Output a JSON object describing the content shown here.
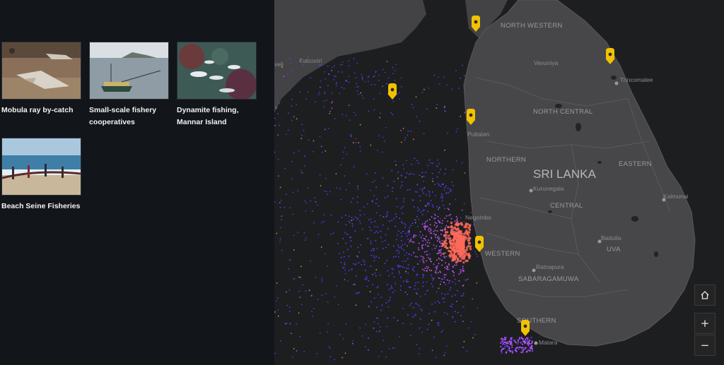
{
  "gallery": [
    {
      "caption": "Mobula ray by-catch"
    },
    {
      "caption": "Small-scale fishery cooperatives"
    },
    {
      "caption": "Dynamite fishing, Mannar Island"
    },
    {
      "caption": "Beach Seine Fisheries"
    }
  ],
  "map": {
    "country_label": "SRI LANKA",
    "region_labels": [
      "NORTH WESTERN",
      "NORTH CENTRAL",
      "NORTHERN",
      "EASTERN",
      "CENTRAL",
      "WESTERN",
      "UVA",
      "SABARAGAMUWA",
      "SOUTHERN"
    ],
    "city_labels": [
      "Tuticorin",
      "Vavuniya",
      "Trincomalee",
      "Puttalan",
      "Kurunegala",
      "Kalmunai",
      "Negombo",
      "Badulla",
      "Ratnapura",
      "Matara",
      "veli"
    ],
    "marker_count": 7,
    "colors": {
      "water": "#1b1c1e",
      "land": "#454548",
      "marker": "#f2c200",
      "heat_low": "#5b3cff",
      "heat_mid": "#c25aff",
      "heat_high": "#ff6a5a"
    }
  },
  "controls": {
    "home_icon": "home-icon",
    "zoom_in_label": "+",
    "zoom_out_label": "−"
  }
}
